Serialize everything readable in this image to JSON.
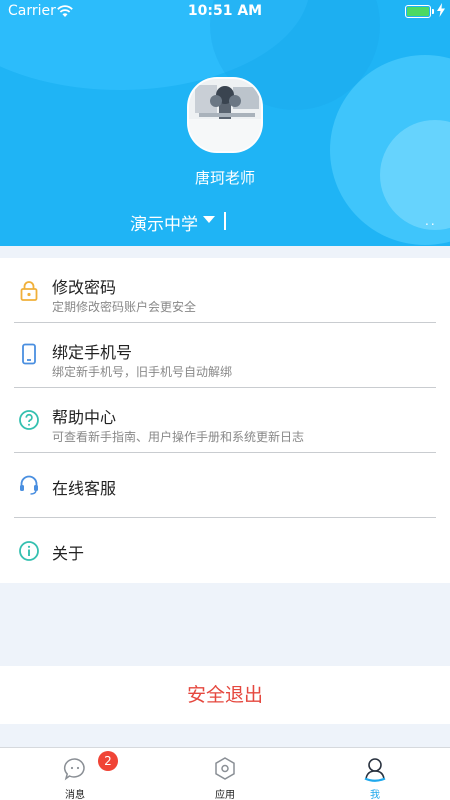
{
  "status_bar": {
    "carrier": "Carrier",
    "time": "10:51 AM",
    "battery_level": 1.0
  },
  "profile": {
    "name": "唐珂老师",
    "school": "演示中学",
    "more": ".."
  },
  "menu": [
    {
      "title": "修改密码",
      "subtitle": "定期修改密码账户会更安全",
      "icon": "lock-icon"
    },
    {
      "title": "绑定手机号",
      "subtitle": "绑定新手机号，旧手机号自动解绑",
      "icon": "phone-icon"
    },
    {
      "title": "帮助中心",
      "subtitle": "可查看新手指南、用户操作手册和系统更新日志",
      "icon": "help-icon"
    },
    {
      "title": "在线客服",
      "subtitle": "",
      "icon": "headset-icon"
    },
    {
      "title": "关于",
      "subtitle": "",
      "icon": "info-icon"
    }
  ],
  "logout_label": "安全退出",
  "tabs": [
    {
      "label": "消息",
      "badge": "2",
      "icon": "chat-bubble-icon"
    },
    {
      "label": "应用",
      "icon": "hexagon-icon"
    },
    {
      "label": "我",
      "icon": "user-icon",
      "active": true
    }
  ],
  "colors": {
    "header": "#1fb4f5",
    "accent": "#1fa8ec",
    "logout": "#e5483f",
    "badge": "#f04436"
  }
}
